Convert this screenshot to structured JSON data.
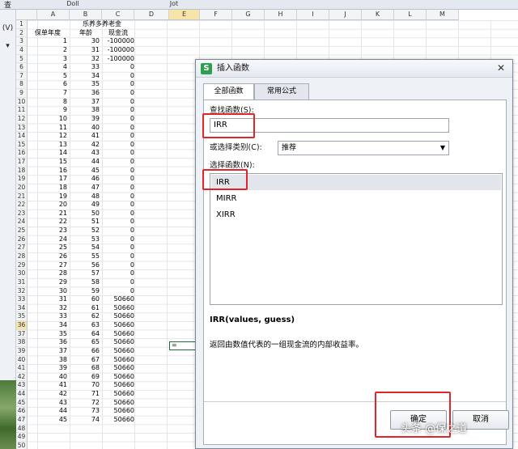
{
  "top_tabs": [
    "Doll",
    "Jot"
  ],
  "left_strip": [
    "查",
    "(V)",
    "▾"
  ],
  "columns": [
    "A",
    "B",
    "C",
    "D",
    "E",
    "F",
    "G",
    "H",
    "I",
    "J",
    "K",
    "L",
    "M"
  ],
  "active_column": "E",
  "active_row": 36,
  "sheet": {
    "title": "乐养多养老金",
    "headers": [
      "保单年度",
      "年龄",
      "现金流"
    ],
    "rows": [
      [
        1,
        30,
        "-100000"
      ],
      [
        2,
        31,
        "-100000"
      ],
      [
        3,
        32,
        "-100000"
      ],
      [
        4,
        33,
        "0"
      ],
      [
        5,
        34,
        "0"
      ],
      [
        6,
        35,
        "0"
      ],
      [
        7,
        36,
        "0"
      ],
      [
        8,
        37,
        "0"
      ],
      [
        9,
        38,
        "0"
      ],
      [
        10,
        39,
        "0"
      ],
      [
        11,
        40,
        "0"
      ],
      [
        12,
        41,
        "0"
      ],
      [
        13,
        42,
        "0"
      ],
      [
        14,
        43,
        "0"
      ],
      [
        15,
        44,
        "0"
      ],
      [
        16,
        45,
        "0"
      ],
      [
        17,
        46,
        "0"
      ],
      [
        18,
        47,
        "0"
      ],
      [
        19,
        48,
        "0"
      ],
      [
        20,
        49,
        "0"
      ],
      [
        21,
        50,
        "0"
      ],
      [
        22,
        51,
        "0"
      ],
      [
        23,
        52,
        "0"
      ],
      [
        24,
        53,
        "0"
      ],
      [
        25,
        54,
        "0"
      ],
      [
        26,
        55,
        "0"
      ],
      [
        27,
        56,
        "0"
      ],
      [
        28,
        57,
        "0"
      ],
      [
        29,
        58,
        "0"
      ],
      [
        30,
        59,
        "0"
      ],
      [
        31,
        60,
        "50660"
      ],
      [
        32,
        61,
        "50660"
      ],
      [
        33,
        62,
        "50660"
      ],
      [
        34,
        63,
        "50660"
      ],
      [
        35,
        64,
        "50660"
      ],
      [
        36,
        65,
        "50660"
      ],
      [
        37,
        66,
        "50660"
      ],
      [
        38,
        67,
        "50660"
      ],
      [
        39,
        68,
        "50660"
      ],
      [
        40,
        69,
        "50660"
      ],
      [
        41,
        70,
        "50660"
      ],
      [
        42,
        71,
        "50660"
      ],
      [
        43,
        72,
        "50660"
      ],
      [
        44,
        73,
        "50660"
      ],
      [
        45,
        74,
        "50660"
      ]
    ],
    "active_cell_value": "="
  },
  "dialog": {
    "title": "插入函数",
    "logo": "S",
    "close": "✕",
    "tabs": [
      "全部函数",
      "常用公式"
    ],
    "search_label": "查找函数(S):",
    "search_value": "IRR",
    "category_label": "或选择类别(C):",
    "category_value": "推荐",
    "list_label": "选择函数(N):",
    "functions": [
      "IRR",
      "MIRR",
      "XIRR"
    ],
    "signature": "IRR(values, guess)",
    "description": "返回由数值代表的一组现金流的内部收益率。",
    "ok": "确定",
    "cancel": "取消"
  },
  "watermark": "头条 @保之道",
  "highlight_color": "#e0262a"
}
